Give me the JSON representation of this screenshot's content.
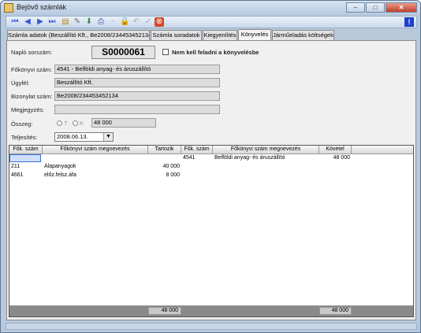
{
  "window": {
    "title": "Bejövő számlák",
    "buttons": {
      "minimize": "–",
      "maximize": "□",
      "close": "✕"
    }
  },
  "toolbar": {
    "icons": [
      "first-icon",
      "prev-icon",
      "next-icon",
      "last-icon",
      "new-icon",
      "edit-icon",
      "save-icon",
      "print-icon",
      "copy-icon",
      "lock-icon",
      "undo-icon",
      "confirm-icon",
      "delete-icon"
    ],
    "help_label": "!"
  },
  "tabs": [
    {
      "label": "Számla adatok (Beszállító Kft., Be2008/234453452134)",
      "active": false
    },
    {
      "label": "Számla soradatok",
      "active": false
    },
    {
      "label": "Kiegyenlítés",
      "active": false
    },
    {
      "label": "Könyvelés",
      "active": true
    },
    {
      "label": "Járműeladás költségek",
      "active": false
    }
  ],
  "form": {
    "naplo_label": "Napló sorszám:",
    "naplo_value": "S0000061",
    "nem_kell_label": "Nem kell feladni a könyvelésbe",
    "nem_kell_checked": false,
    "fokonyvi_label": "Főkönyvi szám:",
    "fokonyvi_value": "4541 - Belföldi anyag- és áruszállító",
    "ugyfel_label": "Ügyfél:",
    "ugyfel_value": "Beszállító Kft.",
    "bizonylat_label": "Bizonylat szám:",
    "bizonylat_value": "Be2008/234453452134",
    "megjegyzes_label": "Megjegyzés:",
    "megjegyzes_value": "",
    "osszeg_label": "Összeg:",
    "osszeg_t": "T",
    "osszeg_k": "K",
    "osszeg_value": "48 000",
    "teljesites_label": "Teljesítés:",
    "teljesites_value": "2008.06.13."
  },
  "grid": {
    "headers": {
      "fok_szam_left": "Fők. szám",
      "megnevezes_left": "Főkönyvi szám megnevezés",
      "tartozik": "Tartozik",
      "fok_szam_right": "Fők. szám",
      "megnevezes_right": "Főkönyvi szám megnevezés",
      "kovetel": "Követel"
    },
    "rows": [
      {
        "fok_szam_left": "",
        "megnevezes_left": "",
        "tartozik": "",
        "fok_szam_right": "4541",
        "megnevezes_right": "Belföldi anyag- és áruszállító",
        "kovetel": "48 000"
      },
      {
        "fok_szam_left": "211",
        "megnevezes_left": "Alapanyagok",
        "tartozik": "40 000",
        "fok_szam_right": "",
        "megnevezes_right": "",
        "kovetel": ""
      },
      {
        "fok_szam_left": "4661",
        "megnevezes_left": "előz.felsz.áfa",
        "tartozik": "8 000",
        "fok_szam_right": "",
        "megnevezes_right": "",
        "kovetel": ""
      }
    ],
    "footer": {
      "tartozik_total": "48 000",
      "kovetel_total": "48 000"
    }
  }
}
